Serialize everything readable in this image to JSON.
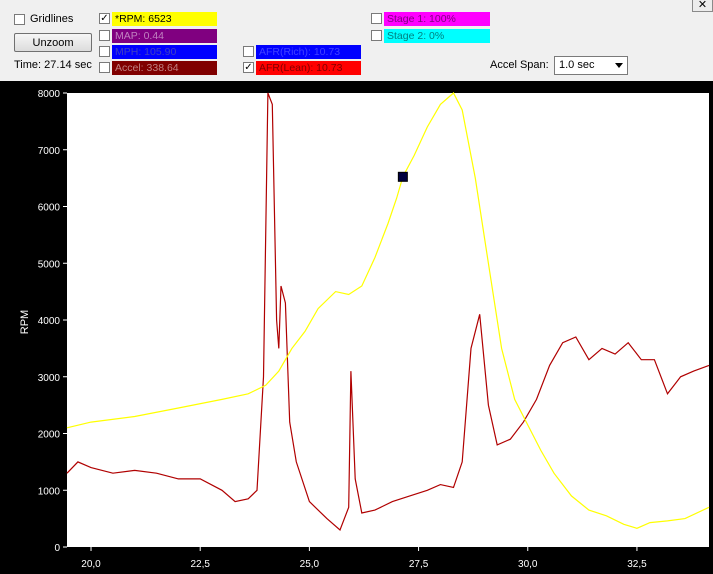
{
  "toolbar": {
    "gridlines_label": "Gridlines",
    "gridlines_checked": false,
    "unzoom_label": "Unzoom",
    "time_text": "Time: 27.14 sec",
    "accel_span_label": "Accel Span:",
    "accel_span_value": "1.0 sec",
    "close_glyph": "✕"
  },
  "channels": [
    {
      "label": "*RPM: 6523",
      "checked": true,
      "color": "#ffff00",
      "text_color": "#000000"
    },
    {
      "label": "MAP: 0.44",
      "checked": false,
      "color": "#800080",
      "text_color": "#c080c0"
    },
    {
      "label": "MPH: 105.90",
      "checked": false,
      "color": "#0000ff",
      "text_color": "#4040c0"
    },
    {
      "label": "Accel: 338.64",
      "checked": false,
      "color": "#800000",
      "text_color": "#c08080"
    },
    {
      "label": "AFR(Rich): 10.73",
      "checked": false,
      "color": "#0000ff",
      "text_color": "#4040ff"
    },
    {
      "label": "AFR(Lean): 10.73",
      "checked": true,
      "color": "#ff0000",
      "text_color": "#800000"
    },
    {
      "label": "Stage 1: 100%",
      "checked": false,
      "color": "#ff00ff",
      "text_color": "#800080"
    },
    {
      "label": "Stage 2: 0%",
      "checked": false,
      "color": "#00ffff",
      "text_color": "#008080"
    }
  ],
  "chart_data": {
    "type": "line",
    "xlabel": "",
    "ylabel": "RPM",
    "xlim": [
      19.45,
      34.15
    ],
    "ylim": [
      0,
      8000
    ],
    "x_ticks": [
      "20,0",
      "22,5",
      "25,0",
      "27,5",
      "30,0",
      "32,5"
    ],
    "y_ticks": [
      "0",
      "1000",
      "2000",
      "3000",
      "4000",
      "5000",
      "6000",
      "7000",
      "8000"
    ],
    "grid": false,
    "cursor": {
      "x": 27.14,
      "y": 6523
    },
    "series": [
      {
        "name": "*RPM",
        "color": "#ffff00",
        "x": [
          19.45,
          20.0,
          21.0,
          22.0,
          23.0,
          23.6,
          24.0,
          24.3,
          24.6,
          24.9,
          25.2,
          25.6,
          25.9,
          26.2,
          26.5,
          26.8,
          27.0,
          27.14,
          27.4,
          27.7,
          28.0,
          28.3,
          28.5,
          28.8,
          29.1,
          29.4,
          29.7,
          30.0,
          30.3,
          30.6,
          31.0,
          31.4,
          31.8,
          32.2,
          32.5,
          32.8,
          33.2,
          33.6,
          34.15
        ],
        "y": [
          2100,
          2200,
          2300,
          2450,
          2600,
          2700,
          2850,
          3100,
          3500,
          3800,
          4200,
          4500,
          4450,
          4600,
          5100,
          5700,
          6150,
          6523,
          6900,
          7400,
          7800,
          8000,
          7700,
          6500,
          5000,
          3500,
          2600,
          2150,
          1700,
          1300,
          900,
          650,
          550,
          400,
          330,
          430,
          460,
          500,
          700
        ]
      },
      {
        "name": "AFR(Lean)",
        "color": "#b00000",
        "x": [
          19.45,
          19.7,
          20.0,
          20.5,
          21.0,
          21.5,
          22.0,
          22.5,
          23.0,
          23.3,
          23.6,
          23.8,
          23.95,
          24.05,
          24.15,
          24.25,
          24.3,
          24.35,
          24.45,
          24.55,
          24.7,
          25.0,
          25.4,
          25.7,
          25.9,
          25.95,
          26.05,
          26.2,
          26.5,
          26.9,
          27.3,
          27.7,
          28.0,
          28.3,
          28.5,
          28.7,
          28.9,
          29.1,
          29.3,
          29.6,
          29.9,
          30.2,
          30.5,
          30.8,
          31.1,
          31.4,
          31.7,
          32.0,
          32.3,
          32.6,
          32.9,
          33.2,
          33.5,
          33.8,
          34.15
        ],
        "y": [
          1300,
          1500,
          1400,
          1300,
          1350,
          1300,
          1200,
          1200,
          1000,
          800,
          850,
          1000,
          3000,
          8000,
          7800,
          4000,
          3500,
          4600,
          4300,
          2200,
          1500,
          800,
          500,
          300,
          700,
          3100,
          1200,
          600,
          650,
          800,
          900,
          1000,
          1100,
          1050,
          1500,
          3500,
          4100,
          2500,
          1800,
          1900,
          2200,
          2600,
          3200,
          3600,
          3700,
          3300,
          3500,
          3400,
          3600,
          3300,
          3300,
          2700,
          3000,
          3100,
          3200
        ]
      }
    ]
  }
}
